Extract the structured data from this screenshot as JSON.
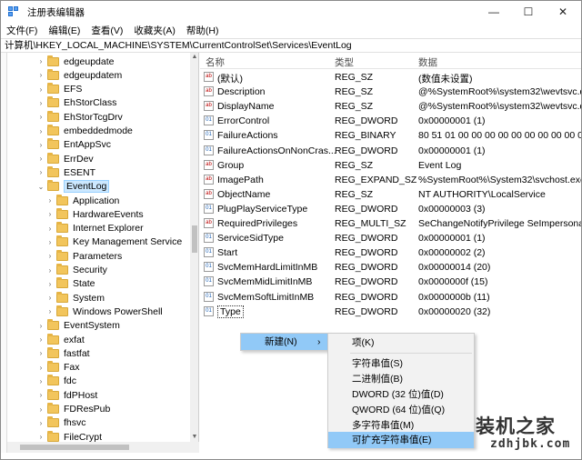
{
  "window": {
    "title": "注册表编辑器"
  },
  "controls": {
    "minimize": "—",
    "maximize": "☐",
    "close": "✕"
  },
  "menu": [
    "文件(F)",
    "编辑(E)",
    "查看(V)",
    "收藏夹(A)",
    "帮助(H)"
  ],
  "address": "计算机\\HKEY_LOCAL_MACHINE\\SYSTEM\\CurrentControlSet\\Services\\EventLog",
  "tree": [
    {
      "label": "edgeupdate",
      "level": 0
    },
    {
      "label": "edgeupdatem",
      "level": 0
    },
    {
      "label": "EFS",
      "level": 0
    },
    {
      "label": "EhStorClass",
      "level": 0
    },
    {
      "label": "EhStorTcgDrv",
      "level": 0
    },
    {
      "label": "embeddedmode",
      "level": 0
    },
    {
      "label": "EntAppSvc",
      "level": 0
    },
    {
      "label": "ErrDev",
      "level": 0
    },
    {
      "label": "ESENT",
      "level": 0
    },
    {
      "label": "EventLog",
      "level": 0,
      "expanded": true,
      "selected": true
    },
    {
      "label": "Application",
      "level": 1
    },
    {
      "label": "HardwareEvents",
      "level": 1
    },
    {
      "label": "Internet Explorer",
      "level": 1
    },
    {
      "label": "Key Management Service",
      "level": 1
    },
    {
      "label": "Parameters",
      "level": 1
    },
    {
      "label": "Security",
      "level": 1
    },
    {
      "label": "State",
      "level": 1
    },
    {
      "label": "System",
      "level": 1
    },
    {
      "label": "Windows PowerShell",
      "level": 1
    },
    {
      "label": "EventSystem",
      "level": 0
    },
    {
      "label": "exfat",
      "level": 0
    },
    {
      "label": "fastfat",
      "level": 0
    },
    {
      "label": "Fax",
      "level": 0
    },
    {
      "label": "fdc",
      "level": 0
    },
    {
      "label": "fdPHost",
      "level": 0
    },
    {
      "label": "FDResPub",
      "level": 0
    },
    {
      "label": "fhsvc",
      "level": 0
    },
    {
      "label": "FileCrypt",
      "level": 0
    }
  ],
  "columns": {
    "name": "名称",
    "type": "类型",
    "data": "数据"
  },
  "values": [
    {
      "name": "(默认)",
      "type": "REG_SZ",
      "data": "(数值未设置)",
      "kind": "str"
    },
    {
      "name": "Description",
      "type": "REG_SZ",
      "data": "@%SystemRoot%\\system32\\wevtsvc.dl",
      "kind": "str"
    },
    {
      "name": "DisplayName",
      "type": "REG_SZ",
      "data": "@%SystemRoot%\\system32\\wevtsvc.dl",
      "kind": "str"
    },
    {
      "name": "ErrorControl",
      "type": "REG_DWORD",
      "data": "0x00000001 (1)",
      "kind": "bin"
    },
    {
      "name": "FailureActions",
      "type": "REG_BINARY",
      "data": "80 51 01 00 00 00 00 00 00 00 00 00 03",
      "kind": "bin"
    },
    {
      "name": "FailureActionsOnNonCras...",
      "type": "REG_DWORD",
      "data": "0x00000001 (1)",
      "kind": "bin"
    },
    {
      "name": "Group",
      "type": "REG_SZ",
      "data": "Event Log",
      "kind": "str"
    },
    {
      "name": "ImagePath",
      "type": "REG_EXPAND_SZ",
      "data": "%SystemRoot%\\System32\\svchost.exe",
      "kind": "str"
    },
    {
      "name": "ObjectName",
      "type": "REG_SZ",
      "data": "NT AUTHORITY\\LocalService",
      "kind": "str"
    },
    {
      "name": "PlugPlayServiceType",
      "type": "REG_DWORD",
      "data": "0x00000003 (3)",
      "kind": "bin"
    },
    {
      "name": "RequiredPrivileges",
      "type": "REG_MULTI_SZ",
      "data": "SeChangeNotifyPrivilege SeImpersonat",
      "kind": "str"
    },
    {
      "name": "ServiceSidType",
      "type": "REG_DWORD",
      "data": "0x00000001 (1)",
      "kind": "bin"
    },
    {
      "name": "Start",
      "type": "REG_DWORD",
      "data": "0x00000002 (2)",
      "kind": "bin"
    },
    {
      "name": "SvcMemHardLimitInMB",
      "type": "REG_DWORD",
      "data": "0x00000014 (20)",
      "kind": "bin"
    },
    {
      "name": "SvcMemMidLimitInMB",
      "type": "REG_DWORD",
      "data": "0x0000000f (15)",
      "kind": "bin"
    },
    {
      "name": "SvcMemSoftLimitInMB",
      "type": "REG_DWORD",
      "data": "0x0000000b (11)",
      "kind": "bin"
    },
    {
      "name": "Type",
      "type": "REG_DWORD",
      "data": "0x00000020 (32)",
      "kind": "bin",
      "focus": true
    }
  ],
  "context_menu": {
    "new": "新建(N)",
    "arrow": "›"
  },
  "submenu": [
    {
      "label": "项(K)"
    },
    {
      "label": "字符串值(S)"
    },
    {
      "label": "二进制值(B)"
    },
    {
      "label": "DWORD (32 位)值(D)"
    },
    {
      "label": "QWORD (64 位)值(Q)"
    },
    {
      "label": "多字符串值(M)"
    },
    {
      "label": "可扩充字符串值(E)",
      "highlighted": true
    }
  ],
  "watermark": {
    "title": "装机之家",
    "url": "zdhjbk.com"
  }
}
